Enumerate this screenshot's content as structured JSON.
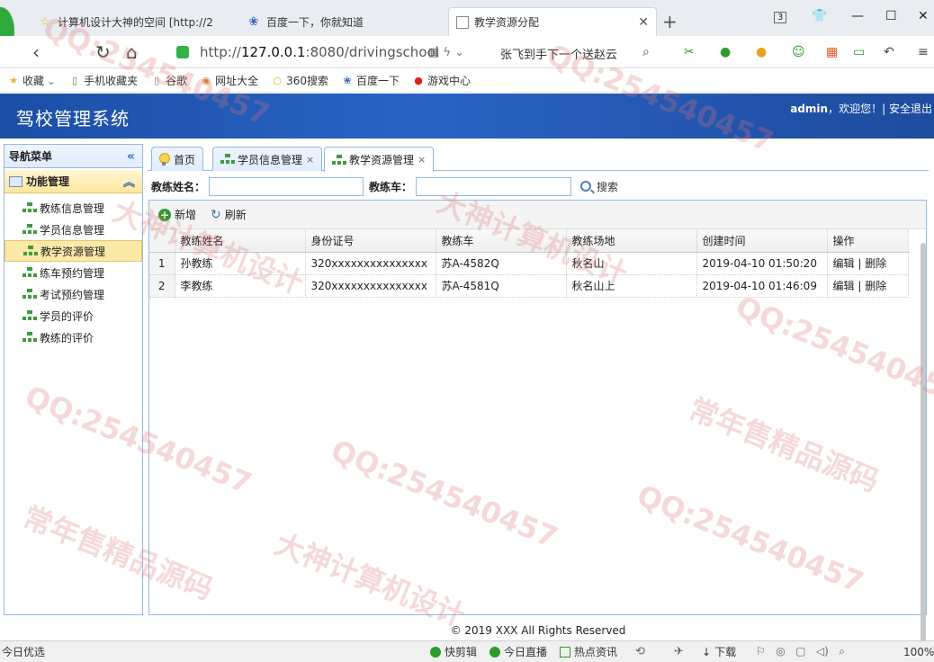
{
  "browser": {
    "tabs": [
      {
        "title": "计算机设计大神的空间 [http://2",
        "icon": "star-icon"
      },
      {
        "title": "百度一下，你就知道",
        "icon": "paw-icon"
      },
      {
        "title": "教学资源分配",
        "icon": "page-icon",
        "active": true
      }
    ],
    "tab_count": "3",
    "url_prefix": "http://",
    "url_host": "127.0.0.1",
    "url_rest": ":8080/drivingschool",
    "search_hint": "张飞到手下一个送赵云",
    "bookmarks": [
      "收藏",
      "手机收藏夹",
      "谷歌",
      "网址大全",
      "360搜索",
      "百度一下",
      "游戏中心"
    ]
  },
  "app": {
    "title": "驾校管理系统",
    "user": "admin",
    "welcome": "，欢迎您！",
    "separator": "|",
    "logout": "安全退出"
  },
  "sidebar": {
    "header": "导航菜单",
    "group": "功能管理",
    "items": [
      "教练信息管理",
      "学员信息管理",
      "教学资源管理",
      "练车预约管理",
      "考试预约管理",
      "学员的评价",
      "教练的评价"
    ],
    "active_index": 2
  },
  "content_tabs": [
    "首页",
    "学员信息管理",
    "教学资源管理"
  ],
  "search": {
    "coach_name_label": "教练姓名：",
    "coach_car_label": "教练车：",
    "search_button": "搜索"
  },
  "toolbar": {
    "add": "新增",
    "refresh": "刷新"
  },
  "table": {
    "columns": [
      "教练姓名",
      "身份证号",
      "教练车",
      "教练场地",
      "创建时间",
      "操作"
    ],
    "rows": [
      {
        "no": "1",
        "name": "孙教练",
        "id": "320xxxxxxxxxxxxxxx",
        "car": "苏A-4582Q",
        "site": "秋名山",
        "created": "2019-04-10 01:50:20",
        "edit": "编辑",
        "sep": "|",
        "delete": "删除"
      },
      {
        "no": "2",
        "name": "李教练",
        "id": "320xxxxxxxxxxxxxxx",
        "car": "苏A-4581Q",
        "site": "秋名山上",
        "created": "2019-04-10 01:46:09",
        "edit": "编辑",
        "sep": "|",
        "delete": "删除"
      }
    ]
  },
  "footer": "© 2019 XXX All Rights Reserved",
  "statusbar": {
    "left": "今日优选",
    "items": [
      "快剪辑",
      "今日直播",
      "热点资讯"
    ],
    "download": "下载",
    "zoom": "100%"
  },
  "watermarks": [
    "QQ:254540457",
    "大神计算机设计",
    "常年售精品源码"
  ],
  "colors": {
    "header_blue": "#1b4fa6",
    "panel_border": "#95b8e7",
    "active_yellow": "#fbe9a8",
    "browser_green": "#2fa93d"
  }
}
